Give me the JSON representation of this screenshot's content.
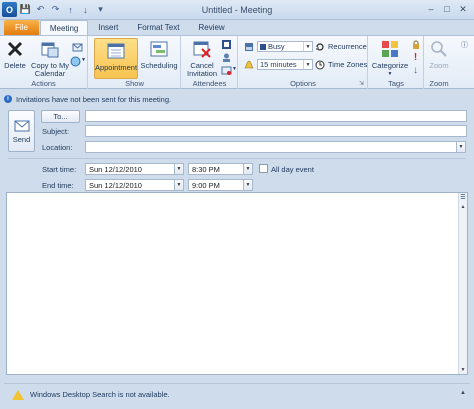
{
  "window": {
    "title": "Untitled  -  Meeting"
  },
  "tabs": [
    {
      "label": "File"
    },
    {
      "label": "Meeting"
    },
    {
      "label": "Insert"
    },
    {
      "label": "Format Text"
    },
    {
      "label": "Review"
    }
  ],
  "ribbon": {
    "actions": {
      "group_label": "Actions",
      "delete": "Delete",
      "copy_line1": "Copy to My",
      "copy_line2": "Calendar"
    },
    "show": {
      "group_label": "Show",
      "appointment": "Appointment",
      "scheduling": "Scheduling"
    },
    "attendees": {
      "group_label": "Attendees",
      "cancel_line1": "Cancel",
      "cancel_line2": "Invitation"
    },
    "options": {
      "group_label": "Options",
      "show_as": "Busy",
      "reminder": "15 minutes",
      "recurrence": "Recurrence",
      "time_zones": "Time Zones"
    },
    "tags": {
      "group_label": "Tags",
      "categorize": "Categorize"
    },
    "zoom": {
      "group_label": "Zoom",
      "zoom": "Zoom"
    }
  },
  "infobar": {
    "message": "Invitations have not been sent for this meeting."
  },
  "form": {
    "send": "Send",
    "to_button": "To...",
    "subject_label": "Subject:",
    "location_label": "Location:",
    "to_value": "",
    "subject_value": "",
    "location_value": "",
    "start_label": "Start time:",
    "end_label": "End time:",
    "start_date": "Sun 12/12/2010",
    "start_time": "8:30 PM",
    "end_date": "Sun 12/12/2010",
    "end_time": "9:00 PM",
    "all_day_label": "All day event",
    "all_day_checked": false
  },
  "status": {
    "message": "Windows Desktop Search is not available."
  }
}
